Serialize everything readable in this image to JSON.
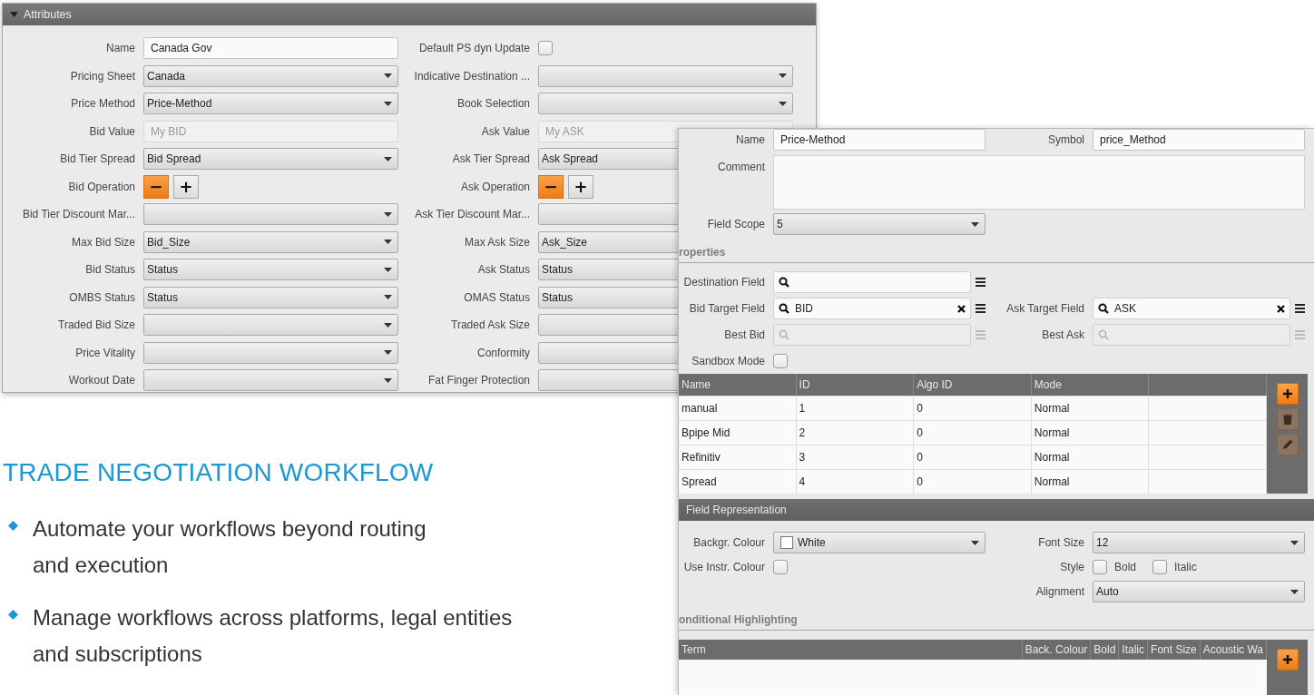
{
  "attributes_window": {
    "title": "Attributes",
    "rows": [
      {
        "left": {
          "label": "Name",
          "kind": "text",
          "value": "Canada Gov"
        },
        "right": {
          "label": "Default PS dyn Update",
          "kind": "checkbox",
          "checked": false
        }
      },
      {
        "left": {
          "label": "Pricing Sheet",
          "kind": "select",
          "value": "Canada"
        },
        "right": {
          "label": "Indicative Destination ...",
          "kind": "select"
        }
      },
      {
        "left": {
          "label": "Price Method",
          "kind": "select",
          "value": "Price-Method"
        },
        "right": {
          "label": "Book Selection",
          "kind": "select"
        }
      },
      {
        "left": {
          "label": "Bid Value",
          "kind": "text",
          "placeholder": "My BID"
        },
        "right": {
          "label": "Ask Value",
          "kind": "text",
          "placeholder": "My ASK"
        }
      },
      {
        "left": {
          "label": "Bid Tier Spread",
          "kind": "select",
          "value": "Bid Spread"
        },
        "right": {
          "label": "Ask Tier Spread",
          "kind": "select",
          "value": "Ask Spread"
        }
      },
      {
        "left": {
          "label": "Bid Operation",
          "kind": "operation",
          "buttons": [
            {
              "label": "−",
              "selected": true
            },
            {
              "label": "+",
              "selected": false
            }
          ]
        },
        "right": {
          "label": "Ask Operation",
          "kind": "operation",
          "buttons": [
            {
              "label": "−",
              "selected": true
            },
            {
              "label": "+",
              "selected": false
            }
          ]
        }
      },
      {
        "left": {
          "label": "Bid Tier Discount Mar...",
          "kind": "select"
        },
        "right": {
          "label": "Ask Tier Discount Mar...",
          "kind": "select"
        }
      },
      {
        "left": {
          "label": "Max Bid Size",
          "kind": "select",
          "value": "Bid_Size"
        },
        "right": {
          "label": "Max Ask Size",
          "kind": "select",
          "value": "Ask_Size"
        }
      },
      {
        "left": {
          "label": "Bid Status",
          "kind": "select",
          "value": "Status"
        },
        "right": {
          "label": "Ask Status",
          "kind": "select",
          "value": "Status"
        }
      },
      {
        "left": {
          "label": "OMBS Status",
          "kind": "select",
          "value": "Status"
        },
        "right": {
          "label": "OMAS Status",
          "kind": "select",
          "value": "Status"
        }
      },
      {
        "left": {
          "label": "Traded Bid Size",
          "kind": "select"
        },
        "right": {
          "label": "Traded Ask Size",
          "kind": "select"
        }
      },
      {
        "left": {
          "label": "Price Vitality",
          "kind": "select"
        },
        "right": {
          "label": "Conformity",
          "kind": "select"
        }
      },
      {
        "left": {
          "label": "Workout Date",
          "kind": "select"
        },
        "right": {
          "label": "Fat Finger Protection",
          "kind": "select"
        }
      }
    ]
  },
  "marketing": {
    "heading": "TRADE NEGOTIATION WORKFLOW",
    "bullets": [
      {
        "lines": [
          "Automate your workflows beyond routing",
          "and execution"
        ]
      },
      {
        "lines": [
          "Manage workflows across platforms, legal entities",
          "and subscriptions"
        ]
      }
    ]
  },
  "price_method_window": {
    "general_rows": [
      {
        "left": {
          "label": "Name",
          "kind": "text",
          "value": "Price-Method"
        },
        "right": {
          "label": "Symbol",
          "kind": "text",
          "value": "price_Method"
        }
      },
      {
        "left": {
          "label": "Comment",
          "kind": "textarea"
        }
      },
      {
        "left": {
          "label": "Field Scope",
          "kind": "select",
          "value": "5"
        }
      }
    ],
    "properties_heading": "roperties",
    "properties_rows": [
      {
        "left": {
          "label": "Destination Field",
          "kind": "search",
          "clearable": false,
          "disabled": false
        }
      },
      {
        "left": {
          "label": "Bid Target Field",
          "kind": "search",
          "value": "BID",
          "clearable": true,
          "disabled": false
        },
        "right": {
          "label": "Ask Target Field",
          "kind": "search",
          "value": "ASK",
          "clearable": true,
          "disabled": false
        }
      },
      {
        "left": {
          "label": "Best Bid",
          "kind": "search",
          "clearable": false,
          "disabled": true
        },
        "right": {
          "label": "Best Ask",
          "kind": "search",
          "clearable": false,
          "disabled": true
        }
      },
      {
        "left": {
          "label": "Sandbox Mode",
          "kind": "checkbox",
          "checked": false
        }
      }
    ],
    "sources_table": {
      "columns": [
        "Name",
        "ID",
        "Algo ID",
        "Mode"
      ],
      "rows": [
        [
          "manual",
          "1",
          "0",
          "Normal"
        ],
        [
          "Bpipe Mid",
          "2",
          "0",
          "Normal"
        ],
        [
          "Refinitiv",
          "3",
          "0",
          "Normal"
        ],
        [
          "Spread",
          "4",
          "0",
          "Normal"
        ]
      ],
      "buttons": [
        {
          "kind": "add",
          "disabled": false
        },
        {
          "kind": "delete",
          "disabled": true
        },
        {
          "kind": "edit",
          "disabled": true
        }
      ]
    },
    "representation_title": "Field Representation",
    "representation_rows": [
      {
        "left": {
          "label": "Backgr. Colour",
          "kind": "colorselect",
          "value": "White"
        },
        "right": {
          "label": "Font Size",
          "kind": "select",
          "value": "12"
        }
      },
      {
        "left": {
          "label": "Use Instr. Colour",
          "kind": "checkbox",
          "checked": false
        },
        "right": {
          "label": "Style",
          "kind": "checkboxes",
          "options": [
            {
              "label": "Bold",
              "checked": false
            },
            {
              "label": "Italic",
              "checked": false
            }
          ]
        }
      },
      {
        "right": {
          "label": "Alignment",
          "kind": "select",
          "value": "Auto"
        }
      }
    ],
    "highlighting_heading": "onditional Highlighting",
    "highlighting_table": {
      "columns": [
        "Term",
        "Back. Colour",
        "Bold",
        "Italic",
        "Font Size",
        "Acoustic Wa"
      ],
      "buttons": [
        {
          "kind": "add",
          "disabled": false
        }
      ]
    }
  }
}
